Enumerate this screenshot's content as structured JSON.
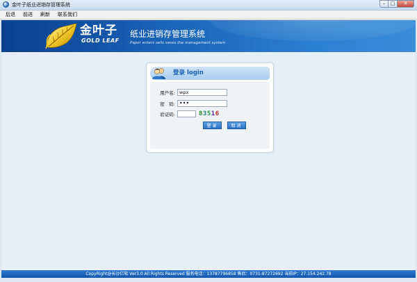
{
  "window": {
    "title": "金叶子纸业进销存管理系统",
    "minimize_icon": "minimize-icon",
    "maximize_icon": "maximize-icon",
    "close_icon": "close-icon"
  },
  "menu": {
    "items": [
      "后退",
      "前进",
      "刷新",
      "联系我们"
    ]
  },
  "banner": {
    "logo_cn": "金叶子",
    "logo_en": "GOLD LEAF",
    "system_title": "纸业进销存管理系统",
    "system_subtitle": "Paper enters sells saves the management system"
  },
  "login": {
    "title": "登录 login",
    "username_label": "用户名:",
    "username_value": "wpx",
    "password_label": "密　码:",
    "password_value": "•••",
    "captcha_label": "验证码:",
    "captcha_value": "",
    "captcha_digits": [
      {
        "char": "8",
        "color": "#2a8a2a"
      },
      {
        "char": "3",
        "color": "#1a7a7a"
      },
      {
        "char": "5",
        "color": "#1d9b3a"
      },
      {
        "char": "1",
        "color": "#4b2aa0"
      },
      {
        "char": "6",
        "color": "#c0282b"
      }
    ],
    "login_button": "登录",
    "cancel_button": "取消"
  },
  "footer": {
    "text": "CopyRight@长沙亿软  Ver3.0 All Rights Reserved  服务电话：13787796858 售后：0731-87272692  当前IP：27.154.242.78"
  },
  "colors": {
    "banner": "#1b64b8",
    "accent": "#1d5fb6",
    "footer": "#1457ad"
  }
}
